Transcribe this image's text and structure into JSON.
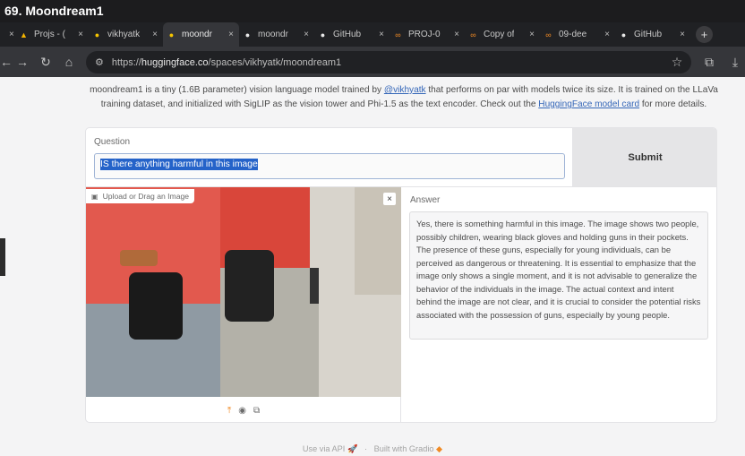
{
  "video_title": "69. Moondream1",
  "tabs": [
    {
      "label": "Projs - (",
      "icon": "drive-icon",
      "icon_glyph": "▲",
      "icon_color": "#f4b400"
    },
    {
      "label": "vikhyatk",
      "icon": "hf-icon",
      "icon_glyph": "●",
      "icon_color": "#f5c400"
    },
    {
      "label": "moondr",
      "icon": "hf-icon",
      "icon_glyph": "●",
      "icon_color": "#f5c400",
      "active": true
    },
    {
      "label": "moondr",
      "icon": "github-icon",
      "icon_glyph": "●",
      "icon_color": "#e8e8e8"
    },
    {
      "label": "GitHub",
      "icon": "github-icon",
      "icon_glyph": "●",
      "icon_color": "#e8e8e8"
    },
    {
      "label": "PROJ-0",
      "icon": "colab-icon",
      "icon_glyph": "∞",
      "icon_color": "#f08a24"
    },
    {
      "label": "Copy of",
      "icon": "colab-icon",
      "icon_glyph": "∞",
      "icon_color": "#f08a24"
    },
    {
      "label": "09-dee",
      "icon": "colab-icon",
      "icon_glyph": "∞",
      "icon_color": "#f08a24"
    },
    {
      "label": "GitHub",
      "icon": "github-icon",
      "icon_glyph": "●",
      "icon_color": "#e8e8e8"
    }
  ],
  "address": {
    "scheme": "https://",
    "host": "huggingface.co",
    "path": "/spaces/vikhyatk/moondream1"
  },
  "description": {
    "part1": "moondream1 is a tiny (1.6B parameter) vision language model trained by ",
    "author_link": "@vikhyatk",
    "part2": " that performs on par with models twice its size. It is trained on the LLaVa training dataset, and initialized with SigLIP as the vision tower and Phi-1.5 as the text encoder. Check out the ",
    "card_link": "HuggingFace model card",
    "part3": " for more details."
  },
  "question": {
    "label": "Question",
    "value": "IS there anything harmful in this image"
  },
  "submit_label": "Submit",
  "image": {
    "upload_label": "Upload or Drag an Image",
    "clear_symbol": "×"
  },
  "answer": {
    "label": "Answer",
    "text": "Yes, there is something harmful in this image. The image shows two people, possibly children, wearing black gloves and holding guns in their pockets. The presence of these guns, especially for young individuals, can be perceived as dangerous or threatening. It is essential to emphasize that the image only shows a single moment, and it is not advisable to generalize the behavior of the individuals in the image. The actual context and intent behind the image are not clear, and it is crucial to consider the potential risks associated with the possession of guns, especially by young people."
  },
  "footer": {
    "api": "Use via API",
    "built": "Built with Gradio"
  }
}
